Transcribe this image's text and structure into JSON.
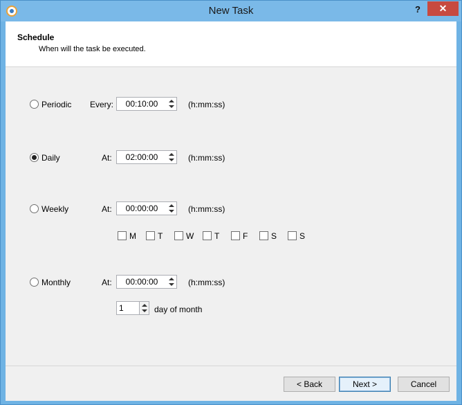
{
  "window": {
    "title": "New Task"
  },
  "titlebar": {
    "help_label": "?",
    "close_label": "✕"
  },
  "header": {
    "title": "Schedule",
    "subtitle": "When will the task be executed."
  },
  "periodic": {
    "label": "Periodic",
    "field_label": "Every:",
    "value": "00:10:00",
    "format": "(h:mm:ss)",
    "selected": false
  },
  "daily": {
    "label": "Daily",
    "field_label": "At:",
    "value": "02:00:00",
    "format": "(h:mm:ss)",
    "selected": true
  },
  "weekly": {
    "label": "Weekly",
    "field_label": "At:",
    "value": "00:00:00",
    "format": "(h:mm:ss)",
    "selected": false,
    "days": [
      "M",
      "T",
      "W",
      "T",
      "F",
      "S",
      "S"
    ]
  },
  "monthly": {
    "label": "Monthly",
    "field_label": "At:",
    "value": "00:00:00",
    "format": "(h:mm:ss)",
    "selected": false,
    "day_value": "1",
    "day_label": "day of month"
  },
  "buttons": {
    "back": "< Back",
    "next": "Next >",
    "cancel": "Cancel"
  },
  "icons": {
    "app": "app-logo-icon",
    "help": "help-icon",
    "close": "close-icon"
  }
}
